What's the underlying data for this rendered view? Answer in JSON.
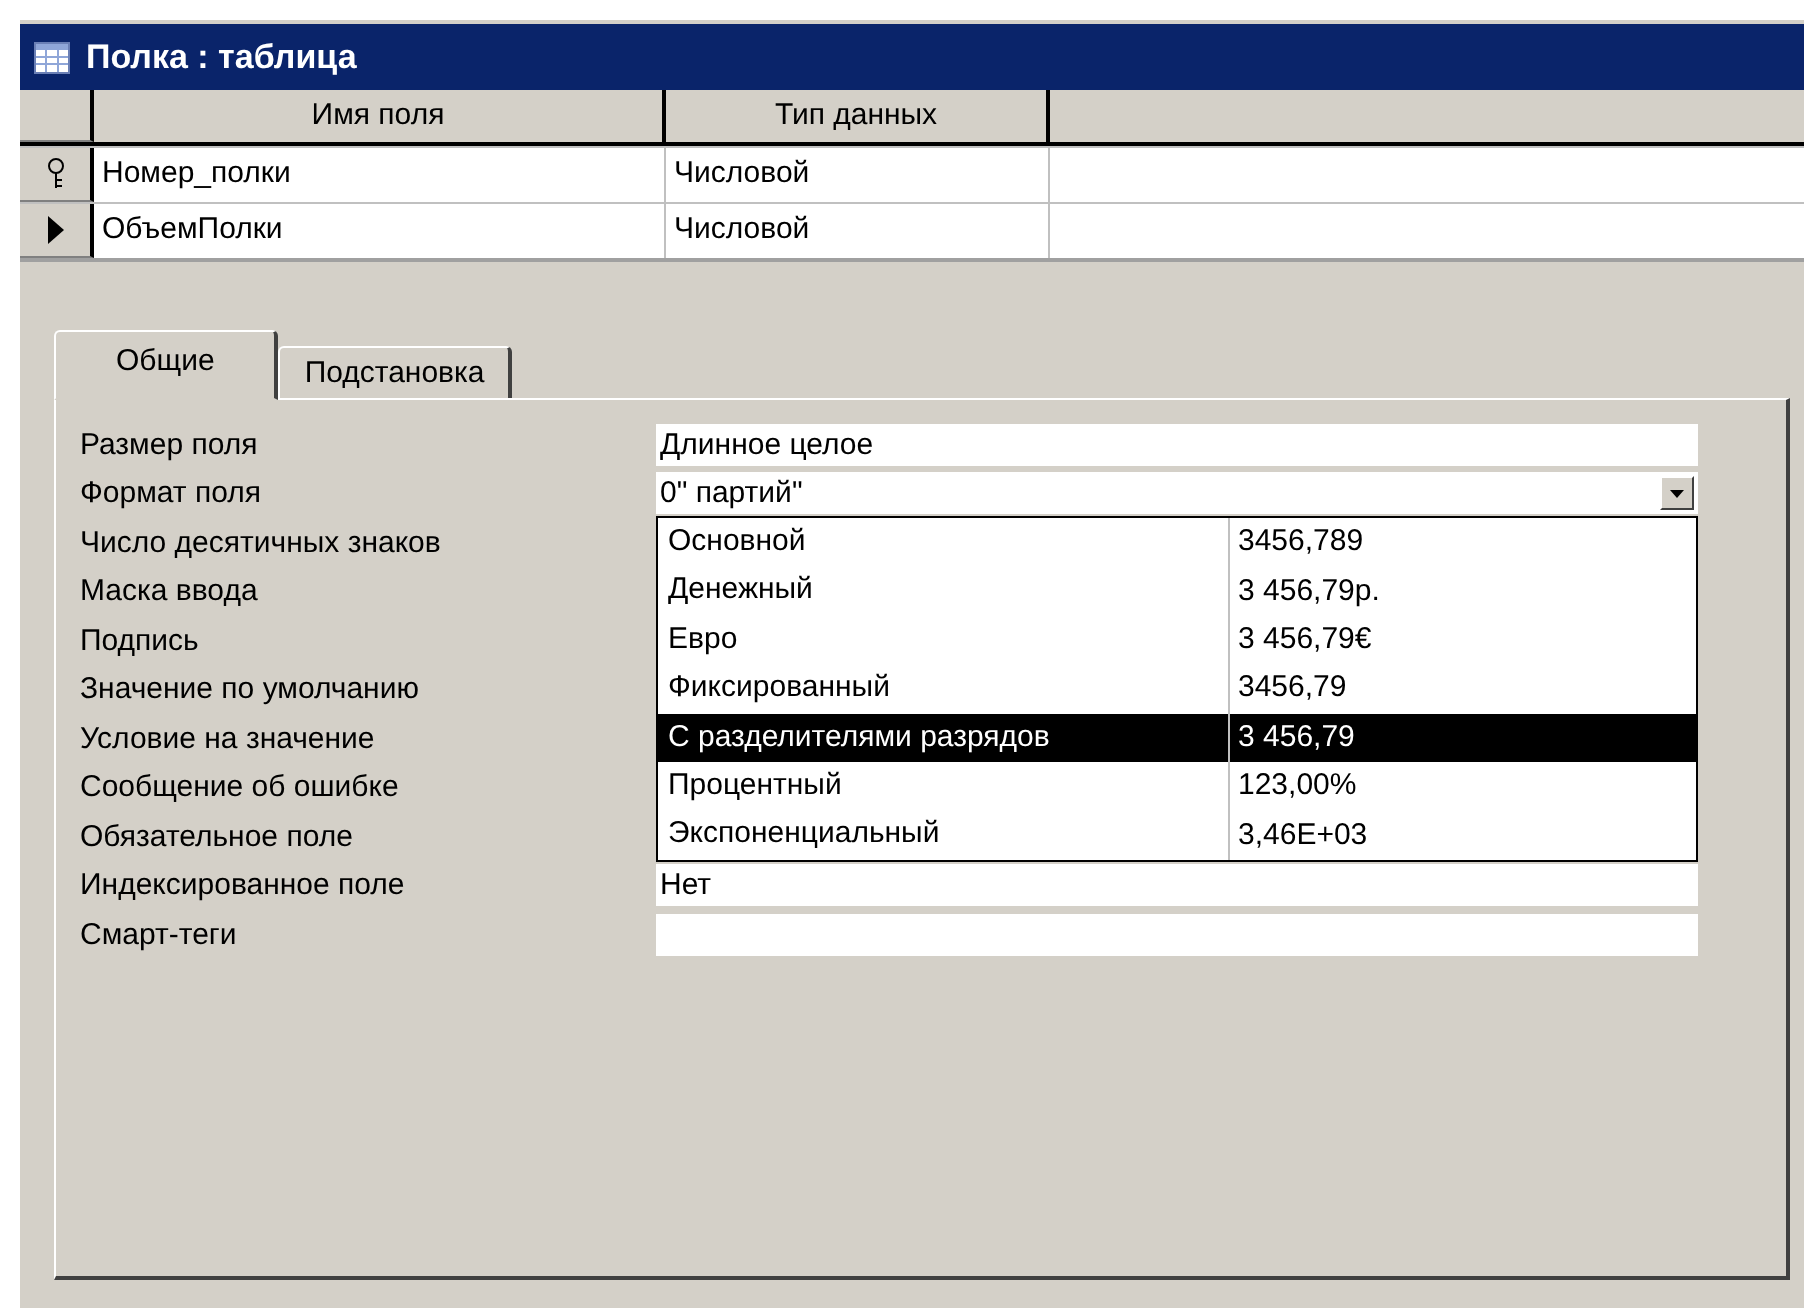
{
  "window": {
    "title": "Полка : таблица"
  },
  "grid": {
    "columns": [
      "Имя поля",
      "Тип данных"
    ],
    "rows": [
      {
        "kind": "key",
        "cells": [
          "Номер_полки",
          "Числовой"
        ]
      },
      {
        "kind": "current",
        "cells": [
          "ОбъемПолки",
          "Числовой"
        ]
      }
    ]
  },
  "tabs": [
    {
      "label": "Общие",
      "selected": true
    },
    {
      "label": "Подстановка",
      "selected": false
    }
  ],
  "properties": [
    {
      "label": "Размер поля",
      "value": "Длинное целое"
    },
    {
      "label": "Формат поля",
      "value": "0\" партий\"",
      "kind": "dropdown"
    },
    {
      "label": "Число десятичных знаков"
    },
    {
      "label": "Маска ввода"
    },
    {
      "label": "Подпись"
    },
    {
      "label": "Значение по умолчанию"
    },
    {
      "label": "Условие на значение"
    },
    {
      "label": "Сообщение об ошибке"
    },
    {
      "label": "Обязательное поле",
      "kind": "field"
    },
    {
      "label": "Индексированное поле",
      "value": "Нет"
    },
    {
      "label": "Смарт-теги",
      "kind": "field"
    }
  ],
  "dropdown_list": [
    {
      "name": "Основной",
      "example": "3456,789",
      "selected": false
    },
    {
      "name": "Денежный",
      "example": "3 456,79р.",
      "selected": false
    },
    {
      "name": "Евро",
      "example": "3 456,79€",
      "selected": false
    },
    {
      "name": "Фиксированный",
      "example": "3456,79",
      "selected": false
    },
    {
      "name": "С разделителями разрядов",
      "example": "3 456,79",
      "selected": true
    },
    {
      "name": "Процентный",
      "example": "123,00%",
      "selected": false
    },
    {
      "name": "Экспоненциальный",
      "example": "3,46E+03",
      "selected": false
    }
  ]
}
